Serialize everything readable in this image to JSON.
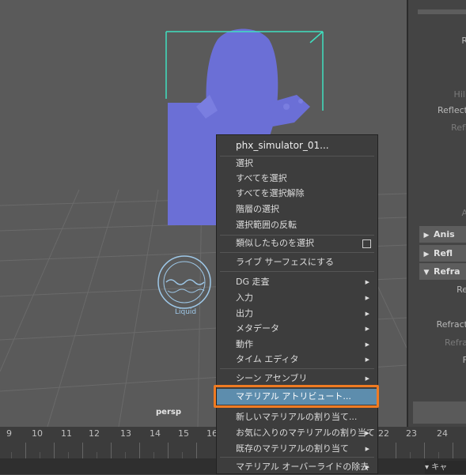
{
  "viewport": {
    "camera_label": "persp",
    "liquid_icon_label": "Liquid"
  },
  "attribute_editor": {
    "labels": [
      "R",
      "Hili",
      "Reflect",
      "Refl",
      "A",
      "Re",
      "Refract",
      "Refra",
      "F"
    ],
    "sections": [
      {
        "label": "Anis",
        "state": "collapsed"
      },
      {
        "label": "Refl",
        "state": "collapsed"
      },
      {
        "label": "Refra",
        "state": "expanded"
      }
    ]
  },
  "timeline": {
    "ticks": [
      "9",
      "10",
      "11",
      "12",
      "13",
      "14",
      "15",
      "16",
      "22",
      "23",
      "24"
    ],
    "field_text": "キャ"
  },
  "context_menu": {
    "title": "phx_simulator_01...",
    "items": [
      {
        "label": "選択"
      },
      {
        "label": "すべてを選択"
      },
      {
        "label": "すべてを選択解除"
      },
      {
        "label": "階層の選択"
      },
      {
        "label": "選択範囲の反転"
      },
      {
        "label": "類似したものを選択"
      },
      {
        "label": "ライブ サーフェスにする"
      },
      {
        "label": "DG 走査"
      },
      {
        "label": "入力"
      },
      {
        "label": "出力"
      },
      {
        "label": "メタデータ"
      },
      {
        "label": "動作"
      },
      {
        "label": "タイム エディタ"
      },
      {
        "label": "シーン アセンブリ"
      },
      {
        "label": "マテリアル アトリビュート..."
      },
      {
        "label": "新しいマテリアルの割り当て..."
      },
      {
        "label": "お気に入りのマテリアルの割り当て"
      },
      {
        "label": "既存のマテリアルの割り当て"
      },
      {
        "label": "マテリアル オーバーライドの除去"
      }
    ],
    "highlighted": "マテリアル アトリビュート..."
  },
  "colors": {
    "viewport_bg": "#5a5a5a",
    "grid": "#6a6a6a",
    "mesh": "#6b6fd6",
    "bbox": "#3fe0c0",
    "highlight": "#5d8dad",
    "annotation": "#f07b22"
  }
}
